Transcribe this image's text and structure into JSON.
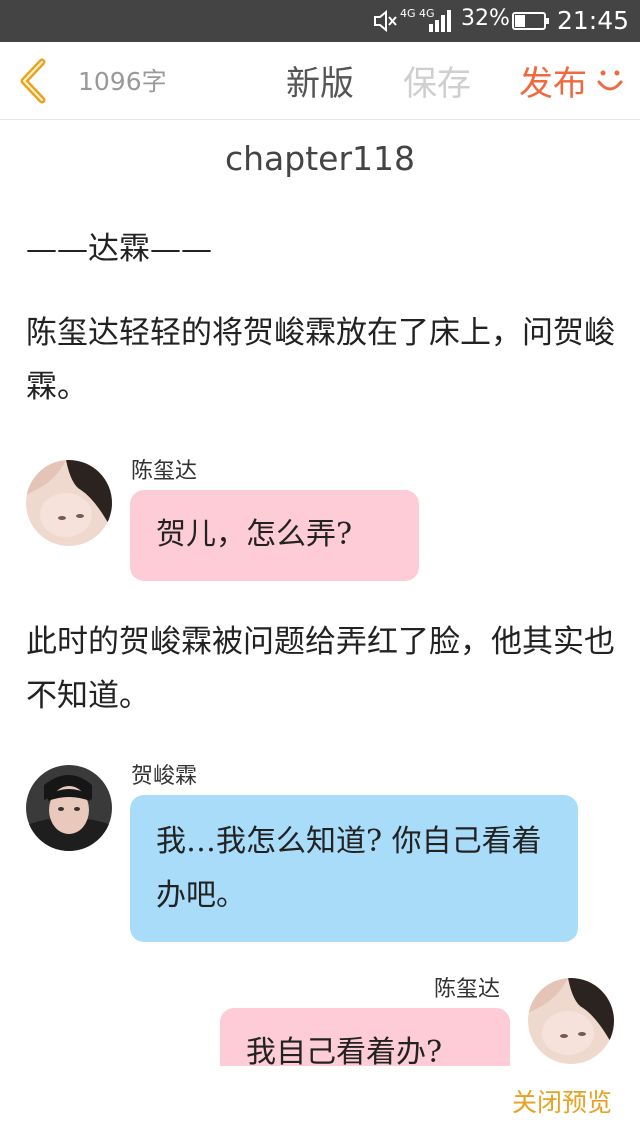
{
  "status_bar": {
    "network": "4G 4G",
    "battery_percent": "32%",
    "time": "21:45",
    "icons": [
      "mute-icon",
      "signal-icon",
      "battery-icon"
    ]
  },
  "toolbar": {
    "word_count": "1096字",
    "new_version_label": "新版",
    "save_label": "保存",
    "publish_label": "发布",
    "colors": {
      "publish": "#ee6b3f",
      "save_disabled": "#cfcfcf",
      "back_icon": "#e9a21f"
    }
  },
  "content": {
    "chapter_title": "chapter118",
    "section_title": "——达霖——",
    "paragraphs": [
      "陈玺达轻轻的将贺峻霖放在了床上，问贺峻霖。",
      "此时的贺峻霖被问题给弄红了脸，他其实也不知道。"
    ],
    "messages": [
      {
        "speaker": "陈玺达",
        "text": "贺儿，怎么弄?",
        "side": "left",
        "color": "#fdccd6"
      },
      {
        "speaker": "贺峻霖",
        "text": "我…我怎么知道? 你自己看着办吧。",
        "side": "left",
        "color": "#a9dcf8"
      },
      {
        "speaker": "陈玺达",
        "text": "我自己看着办?",
        "side": "right",
        "color": "#fdccd6"
      }
    ]
  },
  "footer": {
    "close_preview_label": "关闭预览"
  }
}
